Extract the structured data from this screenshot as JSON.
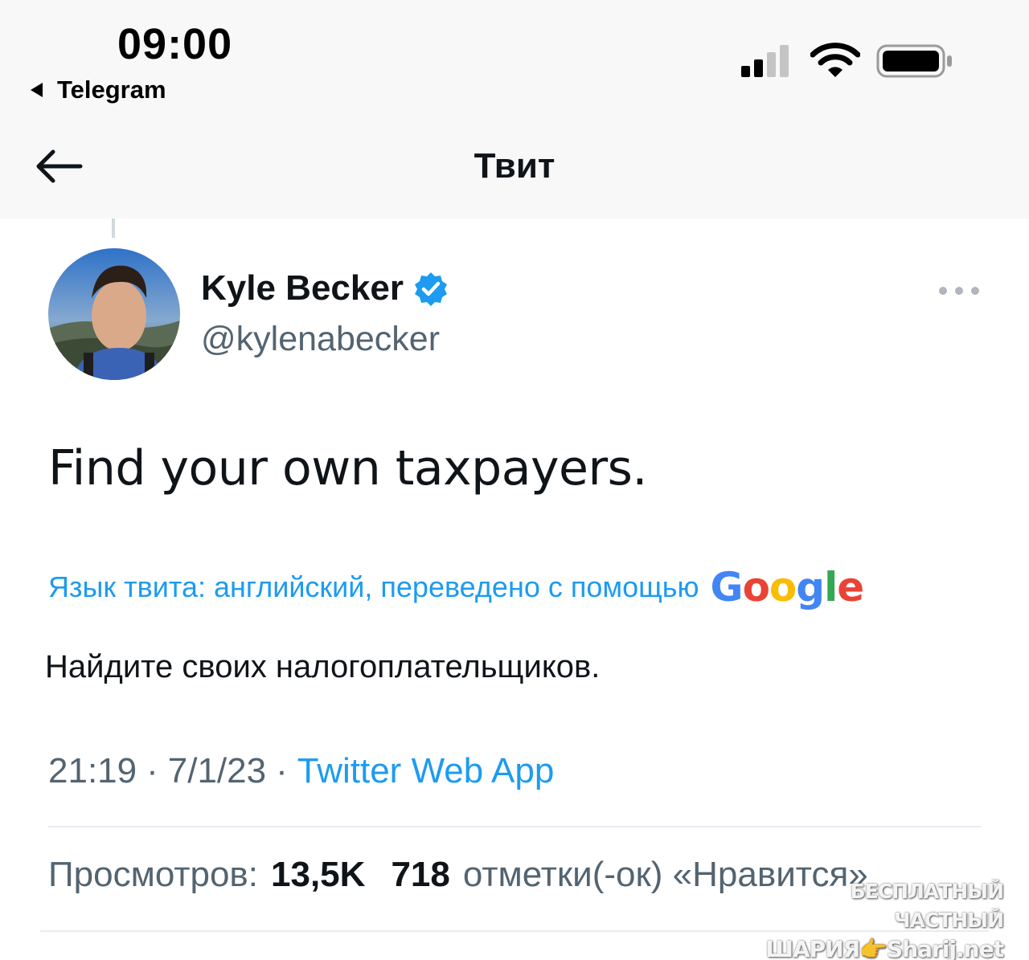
{
  "status_bar": {
    "time": "09:00",
    "back_app": "Telegram",
    "signal_bars_active": 2,
    "signal_bars_total": 4
  },
  "nav": {
    "title": "Твит",
    "back_icon": "arrow-left-icon"
  },
  "tweet": {
    "author_name": "Kyle Becker",
    "author_handle": "@kylenabecker",
    "verified": true,
    "text": "Find your own taxpayers.",
    "translation_label": "Язык твита: английский, переведено с помощью",
    "translation_provider": "Google",
    "translated_text": "Найдите своих налогоплательщиков.",
    "time": "21:19",
    "date": "7/1/23",
    "separator": "·",
    "source": "Twitter Web App",
    "views_label": "Просмотров:",
    "views_count": "13,5K",
    "likes_count": "718",
    "likes_label": "отметки(-ок) «Нравится»"
  },
  "watermark": {
    "line1": "БЕСПЛАТНЫЙ ЧАСТНЫЙ",
    "line2": "ШАРИЯ👉Sharij.net"
  },
  "colors": {
    "accent": "#1d9bf0",
    "secondary_text": "#536471",
    "primary_text": "#0f1419"
  }
}
